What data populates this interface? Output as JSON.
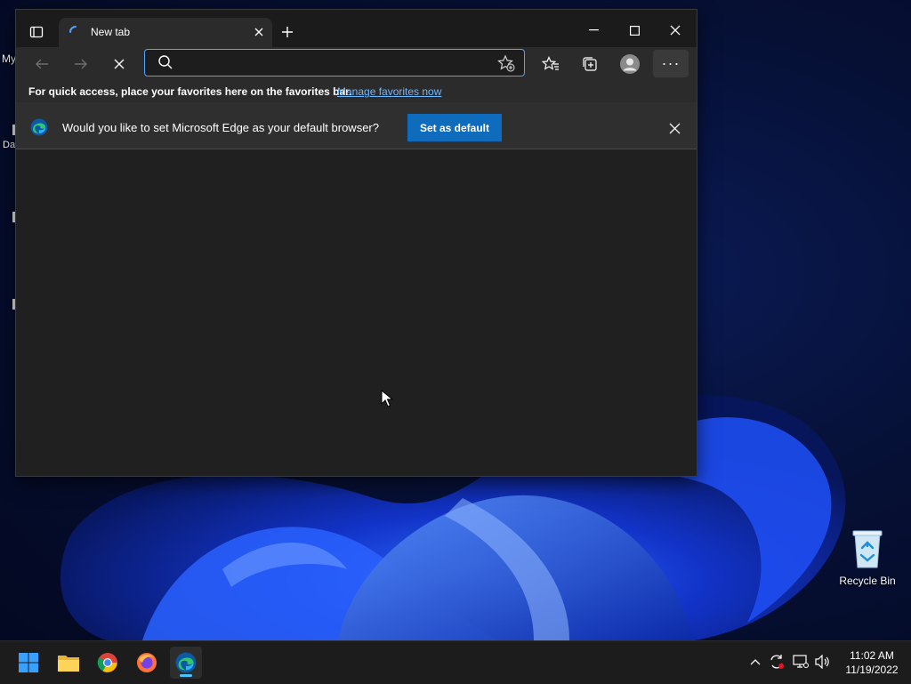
{
  "desktop": {
    "labels": [
      "My",
      "Da"
    ],
    "recycle_bin": "Recycle Bin"
  },
  "browser": {
    "tab_title": "New tab",
    "address_value": "",
    "address_placeholder": "",
    "favbar_text": "For quick access, place your favorites here on the favorites bar.",
    "favbar_link": "Manage favorites now",
    "infobar_message": "Would you like to set Microsoft Edge as your default browser?",
    "infobar_button": "Set as default",
    "more_label": "···",
    "accent": "#0f6cbd"
  },
  "taskbar": {
    "apps": [
      "start-icon",
      "file-explorer-icon",
      "chrome-icon",
      "firefox-icon",
      "edge-icon"
    ],
    "time": "11:02 AM",
    "date": "11/19/2022"
  }
}
